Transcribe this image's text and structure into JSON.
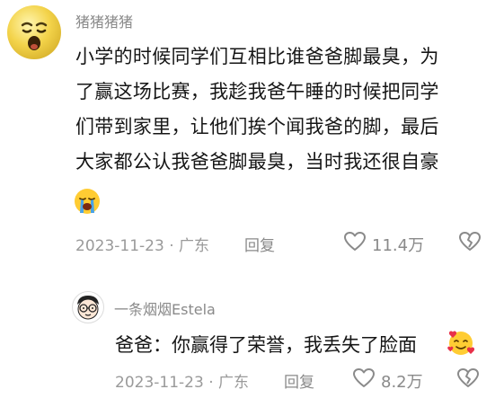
{
  "main_comment": {
    "author": "猪猪猪猪",
    "avatar_icon": "crying-face-avatar-icon",
    "text_lines": [
      "小学的时候同学们互相比谁爸爸脚最臭，为",
      "了赢这场比赛，我趁我爸午睡的时候把同学",
      "们带到家里，让他们挨个闻我爸的脚，最后",
      "大家都公认我爸爸脚最臭，当时我还很自豪"
    ],
    "trailing_emoji": "loudly-crying-face-icon",
    "date": "2023-11-23 · 广东",
    "reply_label": "回复",
    "like_count": "11.4万"
  },
  "reply_comment": {
    "author": "一条烟烟Estela",
    "avatar_icon": "cartoon-face-avatar-icon",
    "text": "爸爸：你赢得了荣誉，我丢失了脸面",
    "trailing_emoji": "smiling-face-with-hearts-icon",
    "date": "2023-11-23 · 广东",
    "reply_label": "回复",
    "like_count": "8.2万"
  },
  "colors": {
    "text_primary": "#161616",
    "text_secondary": "#9a9a9a",
    "icon_gray": "#8a8a8a",
    "background": "#ffffff"
  }
}
